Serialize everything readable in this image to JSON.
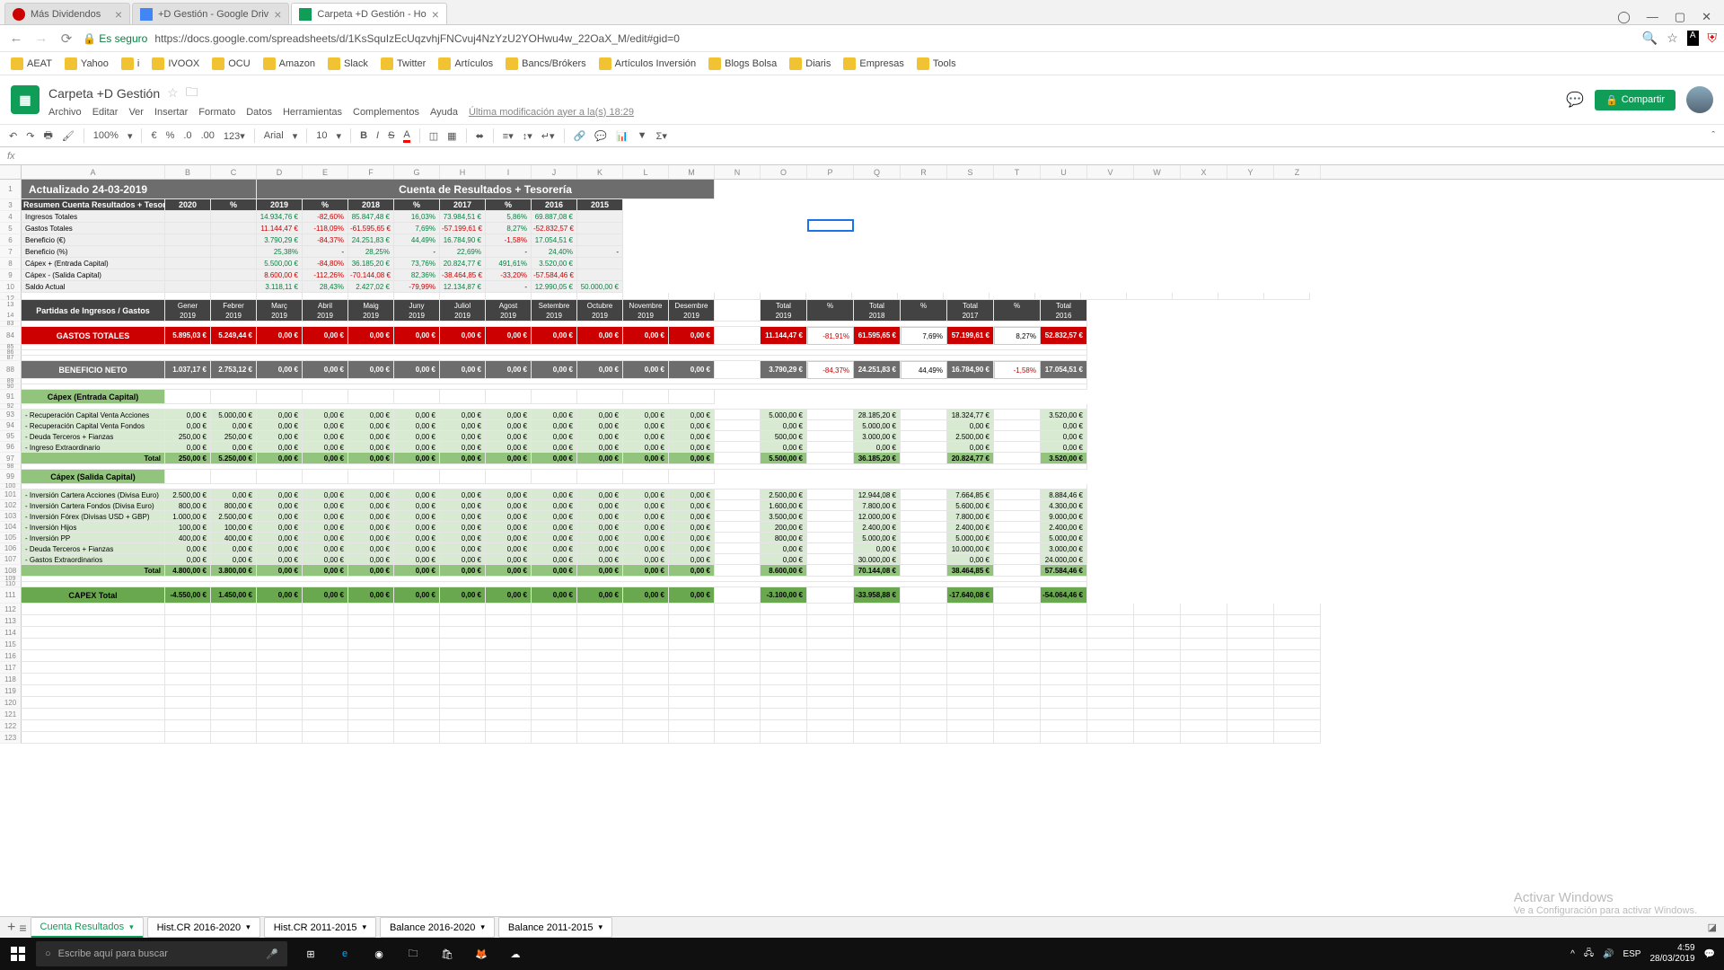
{
  "tabs": [
    {
      "t": "Más Dividendos"
    },
    {
      "t": "+D Gestión - Google Driv"
    },
    {
      "t": "Carpeta +D Gestión - Ho"
    }
  ],
  "url": "https://docs.google.com/spreadsheets/d/1KsSquIzEcUqzvhjFNCvuj4NzYzU2YOHwu4w_22OaX_M/edit#gid=0",
  "secure": "Es seguro",
  "bookmarks": [
    "AEAT",
    "Yahoo",
    "i",
    "IVOOX",
    "OCU",
    "Amazon",
    "Slack",
    "Twitter",
    "Artículos",
    "Bancs/Brókers",
    "Artículos Inversión",
    "Blogs Bolsa",
    "Diaris",
    "Empresas",
    "Tools"
  ],
  "docTitle": "Carpeta +D Gestión",
  "menu": [
    "Archivo",
    "Editar",
    "Ver",
    "Insertar",
    "Formato",
    "Datos",
    "Herramientas",
    "Complementos",
    "Ayuda"
  ],
  "lastEdit": "Última modificación ayer a la(s) 18:29",
  "share": "Compartir",
  "toolbar": {
    "zoom": "100%",
    "font": "Arial",
    "size": "10"
  },
  "cols": [
    "A",
    "B",
    "C",
    "D",
    "E",
    "F",
    "G",
    "H",
    "I",
    "J",
    "K",
    "L",
    "M",
    "N",
    "O",
    "P",
    "Q",
    "R",
    "S",
    "T",
    "U",
    "V",
    "W",
    "X",
    "Y",
    "Z"
  ],
  "title1": "Actualizado  24-03-2019",
  "title2": "Cuenta de Resultados + Tesorería",
  "sumHdr": [
    "Resumen Cuenta Resultados + Tesorería",
    "2020",
    "%",
    "2019",
    "%",
    "2018",
    "%",
    "2017",
    "%",
    "2016",
    "2015"
  ],
  "sumRows": [
    {
      "l": "Ingresos Totales",
      "v": [
        "",
        "",
        "14.934,76 €",
        "-82,60%",
        "85.847,48 €",
        "16,03%",
        "73.984,51 €",
        "5,86%",
        "69.887,08 €",
        ""
      ],
      "cls": [
        "",
        "",
        "green-t",
        "red-t",
        "green-t",
        "green-t",
        "green-t",
        "green-t",
        "green-t",
        ""
      ]
    },
    {
      "l": "Gastos Totales",
      "v": [
        "",
        "",
        "11.144,47 €",
        "-118,09%",
        "-61.595,65 €",
        "7,69%",
        "-57.199,61 €",
        "8,27%",
        "-52.832,57 €",
        ""
      ],
      "cls": [
        "",
        "",
        "red-t",
        "red-t",
        "red-t",
        "green-t",
        "red-t",
        "green-t",
        "red-t",
        ""
      ]
    },
    {
      "l": "Beneficio (€)",
      "v": [
        "",
        "",
        "3.790,29 €",
        "-84,37%",
        "24.251,83 €",
        "44,49%",
        "16.784,90 €",
        "-1,58%",
        "17.054,51 €",
        ""
      ],
      "cls": [
        "",
        "",
        "green-t",
        "red-t",
        "green-t",
        "green-t",
        "green-t",
        "red-t",
        "green-t",
        ""
      ]
    },
    {
      "l": "Beneficio (%)",
      "v": [
        "",
        "",
        "25,38%",
        "-",
        "28,25%",
        "-",
        "22,69%",
        "-",
        "24,40%",
        "-"
      ],
      "cls": [
        "",
        "",
        "green-t",
        "",
        "green-t",
        "",
        "green-t",
        "",
        "green-t",
        ""
      ]
    },
    {
      "l": "Cápex + (Entrada Capital)",
      "v": [
        "",
        "",
        "5.500,00 €",
        "-84,80%",
        "36.185,20 €",
        "73,76%",
        "20.824,77 €",
        "491,61%",
        "3.520,00 €",
        ""
      ],
      "cls": [
        "",
        "",
        "green-t",
        "red-t",
        "green-t",
        "green-t",
        "green-t",
        "green-t",
        "green-t",
        ""
      ]
    },
    {
      "l": "Cápex - (Salida Capital)",
      "v": [
        "",
        "",
        "8.600,00 €",
        "-112,26%",
        "-70.144,08 €",
        "82,36%",
        "-38.464,85 €",
        "-33,20%",
        "-57.584,46 €",
        ""
      ],
      "cls": [
        "",
        "",
        "red-t",
        "red-t",
        "red-t",
        "green-t",
        "red-t",
        "red-t",
        "red-t",
        ""
      ]
    },
    {
      "l": "Saldo Actual",
      "v": [
        "",
        "",
        "3.118,11 €",
        "28,43%",
        "2.427,02 €",
        "-79,99%",
        "12.134,87 €",
        "-",
        "12.990,05 €",
        "50.000,00 €"
      ],
      "cls": [
        "",
        "",
        "green-t",
        "green-t",
        "green-t",
        "red-t",
        "green-t",
        "",
        "green-t",
        "green-t"
      ]
    }
  ],
  "partHdr": [
    "Partidas de Ingresos / Gastos",
    "Gener 2019",
    "Febrer 2019",
    "Març 2019",
    "Abril 2019",
    "Maig 2019",
    "Juny 2019",
    "Juliol 2019",
    "Agost 2019",
    "Setembre 2019",
    "Octubre 2019",
    "Novembre 2019",
    "Desembre 2019"
  ],
  "yearHdr": [
    "Total 2019",
    "%",
    "Total 2018",
    "%",
    "Total 2017",
    "%",
    "Total 2016"
  ],
  "gastos": {
    "l": "GASTOS TOTALES",
    "m": [
      "5.895,03 €",
      "5.249,44 €",
      "0,00 €",
      "0,00 €",
      "0,00 €",
      "0,00 €",
      "0,00 €",
      "0,00 €",
      "0,00 €",
      "0,00 €",
      "0,00 €",
      "0,00 €"
    ],
    "y": [
      "11.144,47 €",
      "-81,91%",
      "61.595,65 €",
      "7,69%",
      "57.199,61 €",
      "8,27%",
      "52.832,57 €"
    ]
  },
  "benef": {
    "l": "BENEFICIO NETO",
    "m": [
      "1.037,17 €",
      "2.753,12 €",
      "0,00 €",
      "0,00 €",
      "0,00 €",
      "0,00 €",
      "0,00 €",
      "0,00 €",
      "0,00 €",
      "0,00 €",
      "0,00 €",
      "0,00 €"
    ],
    "y": [
      "3.790,29 €",
      "-84,37%",
      "24.251,83 €",
      "44,49%",
      "16.784,90 €",
      "-1,58%",
      "17.054,51 €"
    ]
  },
  "capEnt": {
    "h": "Cápex (Entrada Capital)",
    "rows": [
      {
        "l": "- Recuperación Capital Venta Acciones",
        "m": [
          "0,00 €",
          "5.000,00 €",
          "0,00 €",
          "0,00 €",
          "0,00 €",
          "0,00 €",
          "0,00 €",
          "0,00 €",
          "0,00 €",
          "0,00 €",
          "0,00 €",
          "0,00 €"
        ],
        "y": [
          "5.000,00 €",
          "",
          "28.185,20 €",
          "",
          "18.324,77 €",
          "",
          "3.520,00 €"
        ]
      },
      {
        "l": "- Recuperación Capital Venta Fondos",
        "m": [
          "0,00 €",
          "0,00 €",
          "0,00 €",
          "0,00 €",
          "0,00 €",
          "0,00 €",
          "0,00 €",
          "0,00 €",
          "0,00 €",
          "0,00 €",
          "0,00 €",
          "0,00 €"
        ],
        "y": [
          "0,00 €",
          "",
          "5.000,00 €",
          "",
          "0,00 €",
          "",
          "0,00 €"
        ]
      },
      {
        "l": "- Deuda Terceros + Fianzas",
        "m": [
          "250,00 €",
          "250,00 €",
          "0,00 €",
          "0,00 €",
          "0,00 €",
          "0,00 €",
          "0,00 €",
          "0,00 €",
          "0,00 €",
          "0,00 €",
          "0,00 €",
          "0,00 €"
        ],
        "y": [
          "500,00 €",
          "",
          "3.000,00 €",
          "",
          "2.500,00 €",
          "",
          "0,00 €"
        ]
      },
      {
        "l": "- Ingreso Extraordinario",
        "m": [
          "0,00 €",
          "0,00 €",
          "0,00 €",
          "0,00 €",
          "0,00 €",
          "0,00 €",
          "0,00 €",
          "0,00 €",
          "0,00 €",
          "0,00 €",
          "0,00 €",
          "0,00 €"
        ],
        "y": [
          "0,00 €",
          "",
          "0,00 €",
          "",
          "0,00 €",
          "",
          "0,00 €"
        ]
      }
    ],
    "tot": {
      "l": "Total",
      "m": [
        "250,00 €",
        "5.250,00 €",
        "0,00 €",
        "0,00 €",
        "0,00 €",
        "0,00 €",
        "0,00 €",
        "0,00 €",
        "0,00 €",
        "0,00 €",
        "0,00 €",
        "0,00 €"
      ],
      "y": [
        "5.500,00 €",
        "",
        "36.185,20 €",
        "",
        "20.824,77 €",
        "",
        "3.520,00 €"
      ]
    }
  },
  "capSal": {
    "h": "Cápex (Salida Capital)",
    "rows": [
      {
        "l": "- Inversión Cartera Acciones (Divisa Euro)",
        "m": [
          "2.500,00 €",
          "0,00 €",
          "0,00 €",
          "0,00 €",
          "0,00 €",
          "0,00 €",
          "0,00 €",
          "0,00 €",
          "0,00 €",
          "0,00 €",
          "0,00 €",
          "0,00 €"
        ],
        "y": [
          "2.500,00 €",
          "",
          "12.944,08 €",
          "",
          "7.664,85 €",
          "",
          "8.884,46 €"
        ]
      },
      {
        "l": "- Inversión Cartera Fondos (Divisa Euro)",
        "m": [
          "800,00 €",
          "800,00 €",
          "0,00 €",
          "0,00 €",
          "0,00 €",
          "0,00 €",
          "0,00 €",
          "0,00 €",
          "0,00 €",
          "0,00 €",
          "0,00 €",
          "0,00 €"
        ],
        "y": [
          "1.600,00 €",
          "",
          "7.800,00 €",
          "",
          "5.600,00 €",
          "",
          "4.300,00 €"
        ]
      },
      {
        "l": "- Inversión Fórex (Divisas USD + GBP)",
        "m": [
          "1.000,00 €",
          "2.500,00 €",
          "0,00 €",
          "0,00 €",
          "0,00 €",
          "0,00 €",
          "0,00 €",
          "0,00 €",
          "0,00 €",
          "0,00 €",
          "0,00 €",
          "0,00 €"
        ],
        "y": [
          "3.500,00 €",
          "",
          "12.000,00 €",
          "",
          "7.800,00 €",
          "",
          "9.000,00 €"
        ]
      },
      {
        "l": "- Inversión Hijos",
        "m": [
          "100,00 €",
          "100,00 €",
          "0,00 €",
          "0,00 €",
          "0,00 €",
          "0,00 €",
          "0,00 €",
          "0,00 €",
          "0,00 €",
          "0,00 €",
          "0,00 €",
          "0,00 €"
        ],
        "y": [
          "200,00 €",
          "",
          "2.400,00 €",
          "",
          "2.400,00 €",
          "",
          "2.400,00 €"
        ]
      },
      {
        "l": "- Inversión PP",
        "m": [
          "400,00 €",
          "400,00 €",
          "0,00 €",
          "0,00 €",
          "0,00 €",
          "0,00 €",
          "0,00 €",
          "0,00 €",
          "0,00 €",
          "0,00 €",
          "0,00 €",
          "0,00 €"
        ],
        "y": [
          "800,00 €",
          "",
          "5.000,00 €",
          "",
          "5.000,00 €",
          "",
          "5.000,00 €"
        ]
      },
      {
        "l": "- Deuda Terceros + Fianzas",
        "m": [
          "0,00 €",
          "0,00 €",
          "0,00 €",
          "0,00 €",
          "0,00 €",
          "0,00 €",
          "0,00 €",
          "0,00 €",
          "0,00 €",
          "0,00 €",
          "0,00 €",
          "0,00 €"
        ],
        "y": [
          "0,00 €",
          "",
          "0,00 €",
          "",
          "10.000,00 €",
          "",
          "3.000,00 €"
        ]
      },
      {
        "l": "- Gastos Extraordinarios",
        "m": [
          "0,00 €",
          "0,00 €",
          "0,00 €",
          "0,00 €",
          "0,00 €",
          "0,00 €",
          "0,00 €",
          "0,00 €",
          "0,00 €",
          "0,00 €",
          "0,00 €",
          "0,00 €"
        ],
        "y": [
          "0,00 €",
          "",
          "30.000,00 €",
          "",
          "0,00 €",
          "",
          "24.000,00 €"
        ]
      }
    ],
    "tot": {
      "l": "Total",
      "m": [
        "4.800,00 €",
        "3.800,00 €",
        "0,00 €",
        "0,00 €",
        "0,00 €",
        "0,00 €",
        "0,00 €",
        "0,00 €",
        "0,00 €",
        "0,00 €",
        "0,00 €",
        "0,00 €"
      ],
      "y": [
        "8.600,00 €",
        "",
        "70.144,08 €",
        "",
        "38.464,85 €",
        "",
        "57.584,46 €"
      ]
    }
  },
  "capTot": {
    "l": "CAPEX Total",
    "m": [
      "-4.550,00 €",
      "1.450,00 €",
      "0,00 €",
      "0,00 €",
      "0,00 €",
      "0,00 €",
      "0,00 €",
      "0,00 €",
      "0,00 €",
      "0,00 €",
      "0,00 €",
      "0,00 €"
    ],
    "y": [
      "-3.100,00 €",
      "",
      "-33.958,88 €",
      "",
      "-17.640,08 €",
      "",
      "-54.064,46 €"
    ]
  },
  "sheetTabs": [
    "Cuenta Resultados",
    "Hist.CR 2016-2020",
    "Hist.CR 2011-2015",
    "Balance 2016-2020",
    "Balance 2011-2015"
  ],
  "searchPlaceholder": "Escribe aquí para buscar",
  "clock": {
    "time": "4:59",
    "date": "28/03/2019"
  },
  "watermark": {
    "t": "Activar Windows",
    "s": "Ve a Configuración para activar Windows."
  },
  "colW": {
    "A": 160,
    "Bmain": 51,
    "gap": 51,
    "year": 52
  }
}
